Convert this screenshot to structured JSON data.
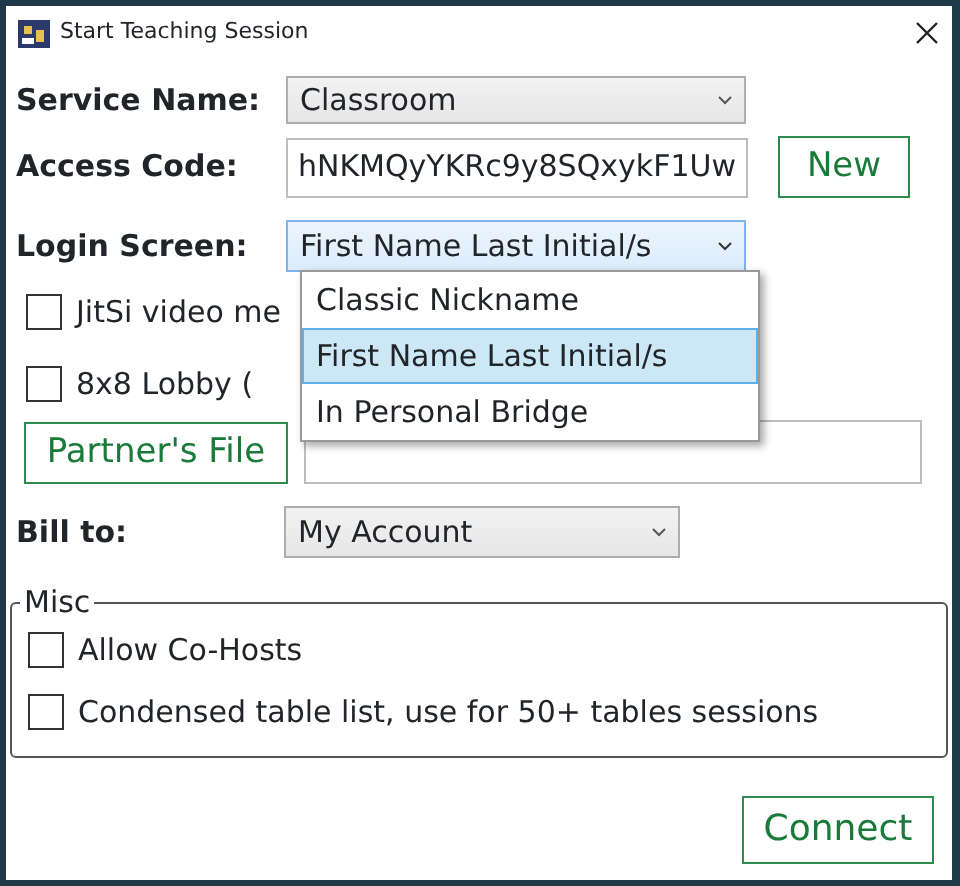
{
  "window": {
    "title": "Start Teaching Session"
  },
  "service_name": {
    "label": "Service Name:",
    "value": "Classroom"
  },
  "access_code": {
    "label": "Access Code:",
    "value": "hNKMQyYKRc9y8SQxykF1Uw",
    "button": "New"
  },
  "login_screen": {
    "label": "Login Screen:",
    "value": "First Name Last Initial/s",
    "expanded": true,
    "options": [
      {
        "label": "Classic Nickname",
        "selected": false
      },
      {
        "label": "First Name Last Initial/s",
        "selected": true
      },
      {
        "label": "In Personal Bridge",
        "selected": false
      }
    ]
  },
  "checkboxes": [
    {
      "label": "JitSi video me",
      "checked": false
    },
    {
      "label": "8x8 Lobby (",
      "checked": false
    }
  ],
  "partners_file": {
    "button": "Partner's File"
  },
  "bill_to": {
    "label": "Bill to:",
    "value": "My Account"
  },
  "misc": {
    "title": "Misc",
    "checkboxes": [
      {
        "label": "Allow Co-Hosts",
        "checked": false
      },
      {
        "label": "Condensed table list, use for 50+ tables sessions",
        "checked": false
      }
    ]
  },
  "connect_button": "Connect"
}
